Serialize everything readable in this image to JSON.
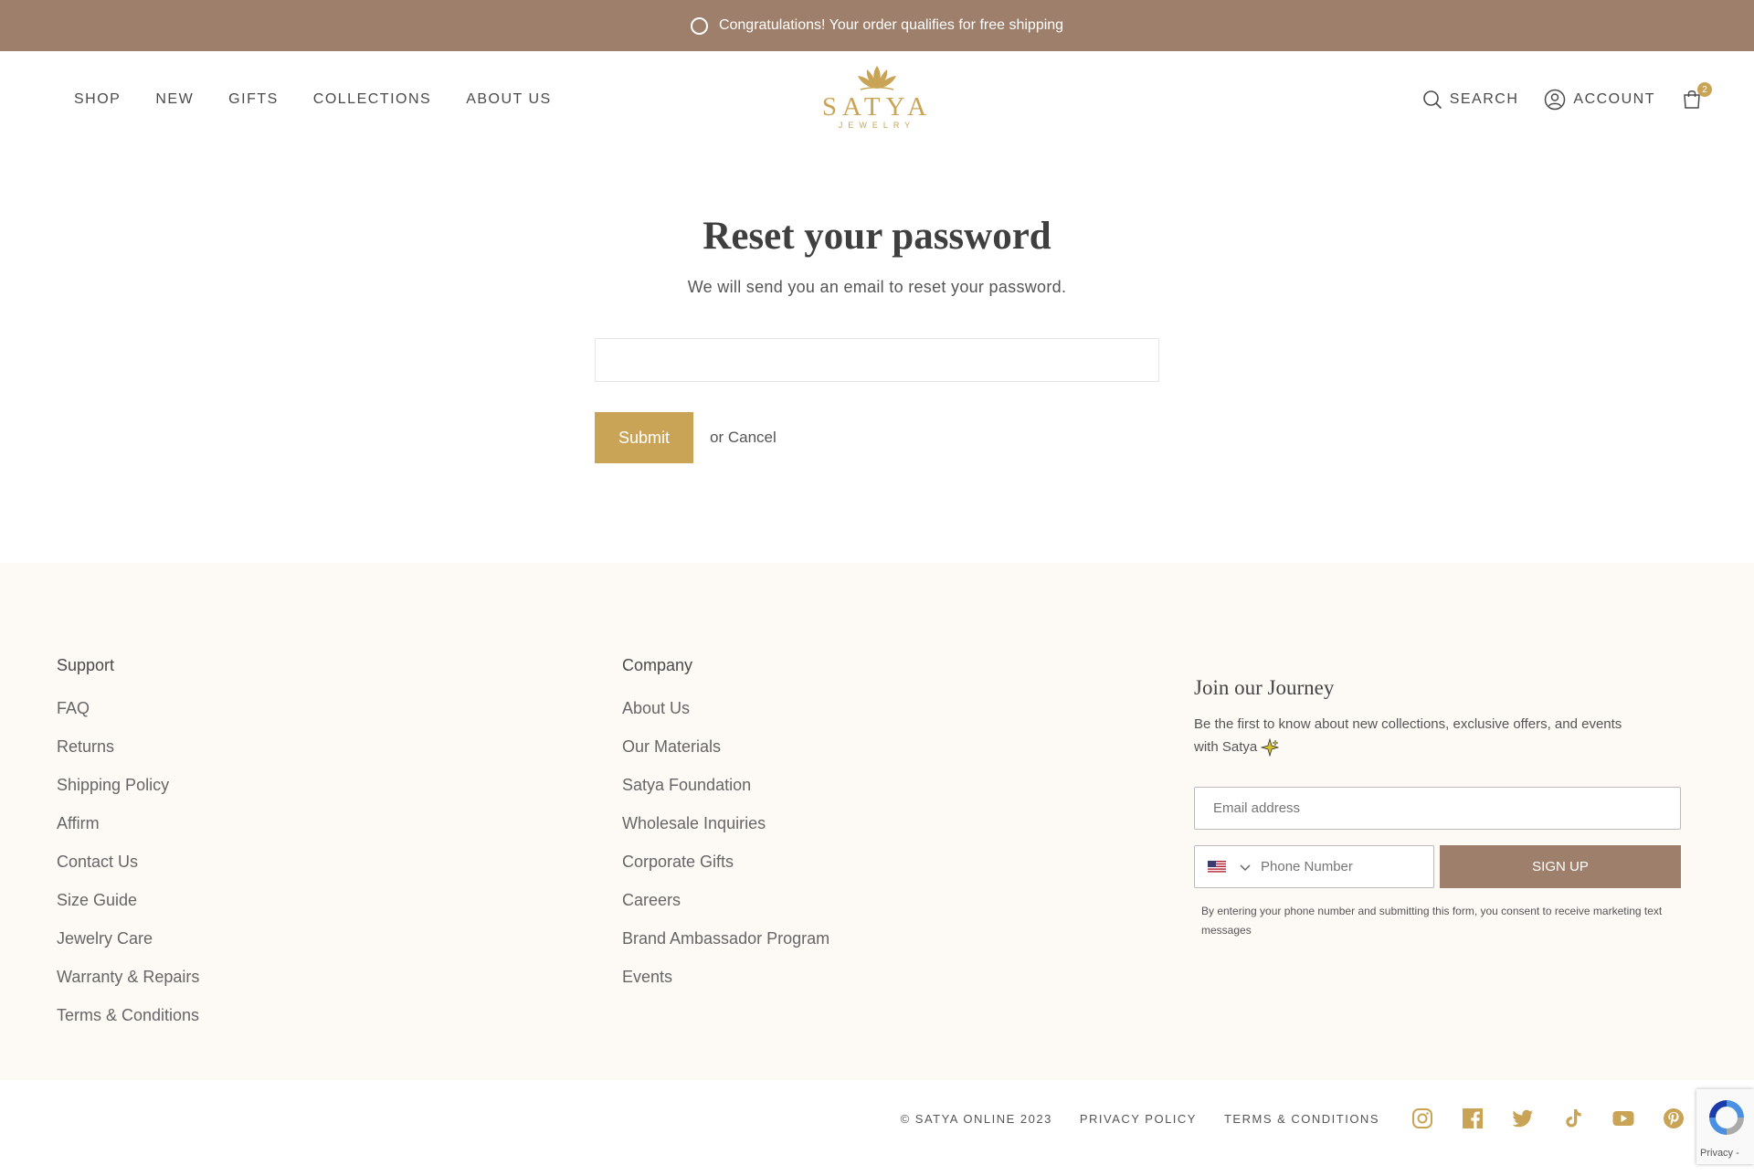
{
  "announcement": {
    "text": "Congratulations! Your order qualifies for free shipping"
  },
  "nav": {
    "items": [
      "SHOP",
      "NEW",
      "GIFTS",
      "COLLECTIONS",
      "ABOUT US"
    ]
  },
  "logo": {
    "brand": "SATYA",
    "sub": "JEWELRY"
  },
  "header_right": {
    "search": "SEARCH",
    "account": "ACCOUNT",
    "cart_count": "2"
  },
  "reset": {
    "title": "Reset your password",
    "subtitle": "We will send you an email to reset your password.",
    "email_value": "",
    "submit_label": "Submit",
    "or_text": "or",
    "cancel_label": "Cancel"
  },
  "footer": {
    "support": {
      "heading": "Support",
      "links": [
        "FAQ",
        "Returns",
        "Shipping Policy",
        "Affirm",
        "Contact Us",
        "Size Guide",
        "Jewelry Care",
        "Warranty & Repairs",
        "Terms & Conditions"
      ]
    },
    "company": {
      "heading": "Company",
      "links": [
        "About Us",
        "Our Materials",
        "Satya Foundation",
        "Wholesale Inquiries",
        "Corporate Gifts",
        "Careers",
        "Brand Ambassador Program",
        "Events"
      ]
    },
    "newsletter": {
      "heading": "Join our Journey",
      "text": "Be the first to know about new collections, exclusive offers, and events with Satya",
      "email_placeholder": "Email address",
      "phone_placeholder": "Phone Number",
      "signup_label": "SIGN UP",
      "consent": "By entering your phone number and submitting this form, you consent to receive marketing text messages"
    }
  },
  "bottom": {
    "copyright": "© SATYA ONLINE 2023",
    "privacy": "PRIVACY POLICY",
    "terms": "TERMS & CONDITIONS",
    "recaptcha_text": "Privacy -"
  },
  "colors": {
    "brown": "#9d7f6b",
    "gold": "#c9a456",
    "footer_bg": "#fdfaf6"
  },
  "icons": {
    "search": "search-icon",
    "account": "account-icon",
    "cart": "shopping-bag-icon",
    "socials": [
      "instagram-icon",
      "facebook-icon",
      "twitter-icon",
      "tiktok-icon",
      "youtube-icon",
      "pinterest-icon"
    ]
  }
}
